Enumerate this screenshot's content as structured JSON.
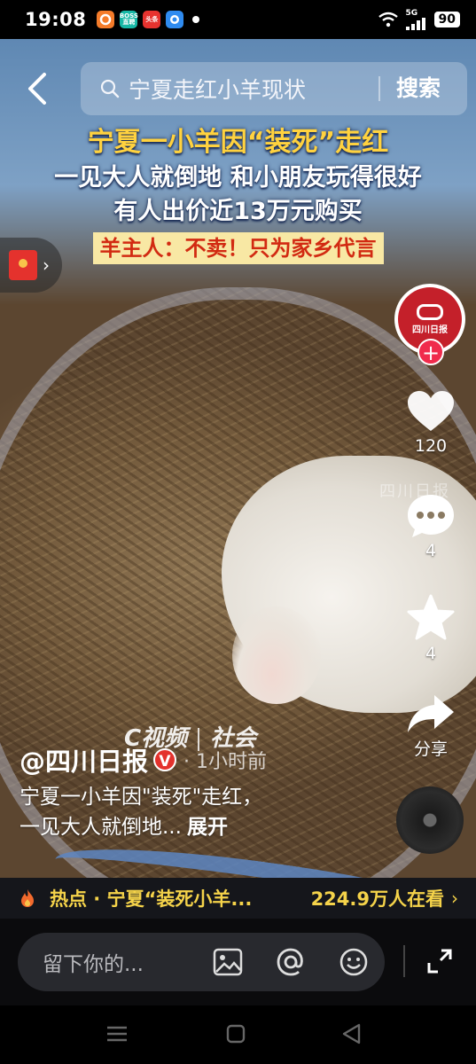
{
  "status_bar": {
    "time": "19:08",
    "notifications": [
      {
        "name": "app-icon-orange",
        "label": "",
        "color": "#f57c2a"
      },
      {
        "name": "boss-zhipin-icon",
        "label": "BOSS直聘",
        "color": "#17b8a6"
      },
      {
        "name": "toutiao-icon",
        "label": "头条",
        "color": "#e7332f"
      },
      {
        "name": "app-icon-blue",
        "label": "",
        "color": "#2f8bf0"
      }
    ],
    "network": "5G",
    "battery": "90"
  },
  "search": {
    "query": "宁夏走红小羊现状",
    "button_label": "搜索"
  },
  "video": {
    "headline_line1": "宁夏一小羊因“装死”走红",
    "headline_line2": "一见大人就倒地  和小朋友玩得很好",
    "headline_line3": "有人出价近13万元购买",
    "headline_highlight": "羊主人：不卖！只为家乡代言",
    "watermark_brand": "C视频",
    "watermark_channel": "社会",
    "watermark_source": "四川日报"
  },
  "author": {
    "name": "@四川日报",
    "verified_mark": "V",
    "time_ago": "· 1小时前",
    "avatar_text": "四川日报"
  },
  "description": {
    "line1": "宁夏一小羊因\"装死\"走红，",
    "line2": "一见大人就倒地...",
    "expand_label": "展开"
  },
  "actions": {
    "follow_label": "+",
    "likes": "120",
    "comments": "4",
    "favorites": "4",
    "share_label": "分享"
  },
  "hot": {
    "text": "热点 · 宁夏“装死小羊...",
    "watching": "224.9万人在看",
    "chevron": "›"
  },
  "comment_bar": {
    "placeholder": "留下你的..."
  },
  "colors": {
    "accent_yellow": "#ffd23f",
    "highlight_red": "#d22a12",
    "like_red": "#f02b4c",
    "brand_red": "#c4202a"
  }
}
